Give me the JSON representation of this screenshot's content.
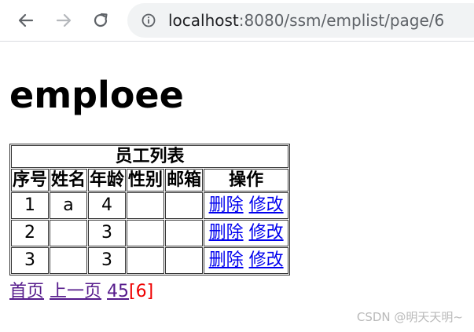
{
  "browser": {
    "url_host": "localhost",
    "url_rest": ":8080/ssm/emplist/page/6"
  },
  "page": {
    "heading": "emploee"
  },
  "table": {
    "caption": "员工列表",
    "headers": [
      "序号",
      "姓名",
      "年龄",
      "性别",
      "邮箱",
      "操作"
    ],
    "rows": [
      {
        "id": "1",
        "name": "a",
        "age": "4",
        "gender": "",
        "email": "",
        "delete_label": "删除",
        "edit_label": "修改"
      },
      {
        "id": "2",
        "name": "",
        "age": "3",
        "gender": "",
        "email": "",
        "delete_label": "删除",
        "edit_label": "修改"
      },
      {
        "id": "3",
        "name": "",
        "age": "3",
        "gender": "",
        "email": "",
        "delete_label": "删除",
        "edit_label": "修改"
      }
    ]
  },
  "pager": {
    "first_label": "首页",
    "prev_label": "上一页",
    "page_4": "4",
    "page_5": "5",
    "current_page": "[6]"
  },
  "watermark": "CSDN @明天天明~",
  "colors": {
    "link": "#0000ee",
    "visited_link": "#551a8b",
    "current_page": "#ee0000"
  }
}
